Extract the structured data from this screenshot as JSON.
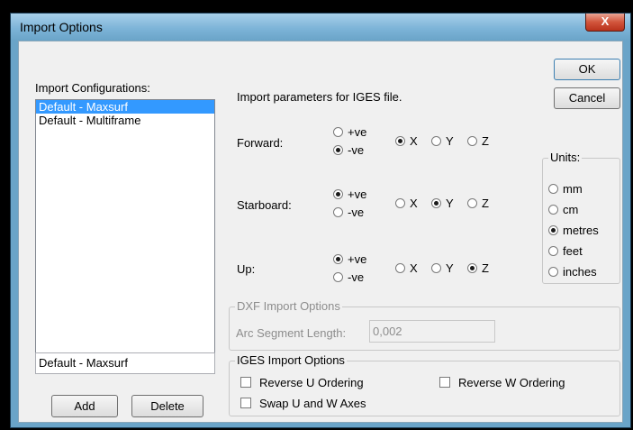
{
  "window": {
    "title": "Import Options",
    "close_glyph": "X"
  },
  "left": {
    "configs_label": "Import Configurations:",
    "configs": [
      "Default - Maxsurf",
      "Default - Multiframe"
    ],
    "selected_index": 0,
    "name_value": "Default - Maxsurf",
    "add_label": "Add",
    "delete_label": "Delete"
  },
  "params": {
    "heading": "Import parameters for IGES file.",
    "sign_pos": "+ve",
    "sign_neg": "-ve",
    "axis_x": "X",
    "axis_y": "Y",
    "axis_z": "Z",
    "rows": [
      {
        "label": "Forward:",
        "sign": "-ve",
        "axis": "X"
      },
      {
        "label": "Starboard:",
        "sign": "+ve",
        "axis": "Y"
      },
      {
        "label": "Up:",
        "sign": "+ve",
        "axis": "Z"
      }
    ]
  },
  "buttons": {
    "ok_label": "OK",
    "cancel_label": "Cancel"
  },
  "units": {
    "legend": "Units:",
    "options": [
      "mm",
      "cm",
      "metres",
      "feet",
      "inches"
    ],
    "selected": "metres"
  },
  "dxf": {
    "legend": "DXF Import Options",
    "arc_label": "Arc Segment Length:",
    "arc_value": "0,002"
  },
  "iges": {
    "legend": "IGES Import Options",
    "reverse_u": "Reverse U Ordering",
    "reverse_w": "Reverse W Ordering",
    "swap_uw": "Swap U and W Axes"
  }
}
